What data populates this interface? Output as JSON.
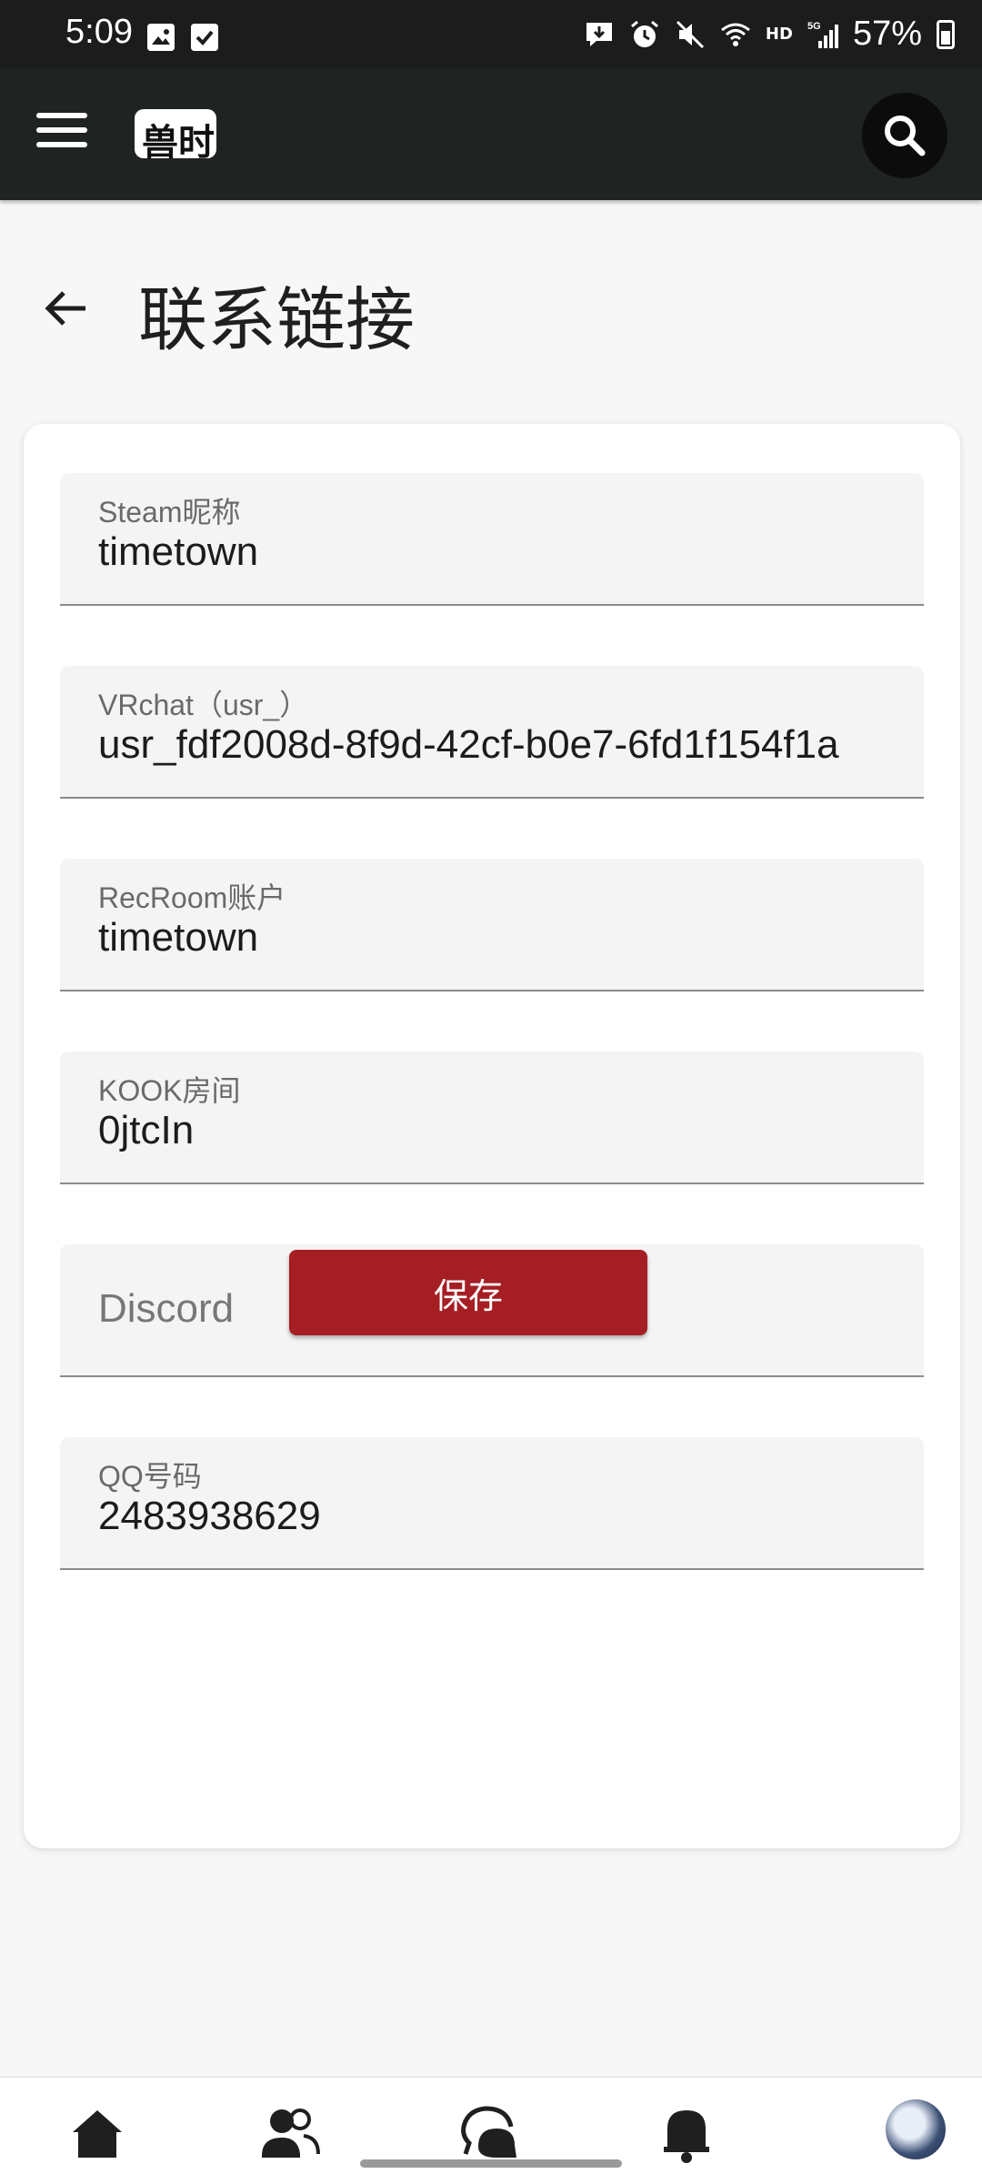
{
  "status_bar": {
    "time": "5:09",
    "battery_percent": "57%",
    "network": "5G",
    "hd_label": "HD"
  },
  "app_bar": {
    "logo_text": "兽时",
    "menu_icon": "hamburger-menu-icon",
    "search_icon": "search-icon"
  },
  "page": {
    "title": "联系链接",
    "back_icon": "arrow-left-icon"
  },
  "form": {
    "fields": [
      {
        "label": "Steam昵称",
        "value": "timetown"
      },
      {
        "label": "VRchat（usr_）",
        "value": "usr_fdf2008d-8f9d-42cf-b0e7-6fd1f154f1a"
      },
      {
        "label": "RecRoom账户",
        "value": "timetown"
      },
      {
        "label": "KOOK房间",
        "value": "0jtcIn"
      },
      {
        "label": "",
        "value": "",
        "placeholder": "Discord"
      },
      {
        "label": "QQ号码",
        "value": "2483938629"
      }
    ],
    "save_label": "保存"
  },
  "bottom_nav": {
    "items": [
      "home-icon",
      "friends-icon",
      "chat-icon",
      "notifications-icon",
      "profile-avatar"
    ]
  },
  "colors": {
    "app_bar": "#1f2322",
    "accent": "#a51e24",
    "field_bg": "#f4f4f4"
  }
}
